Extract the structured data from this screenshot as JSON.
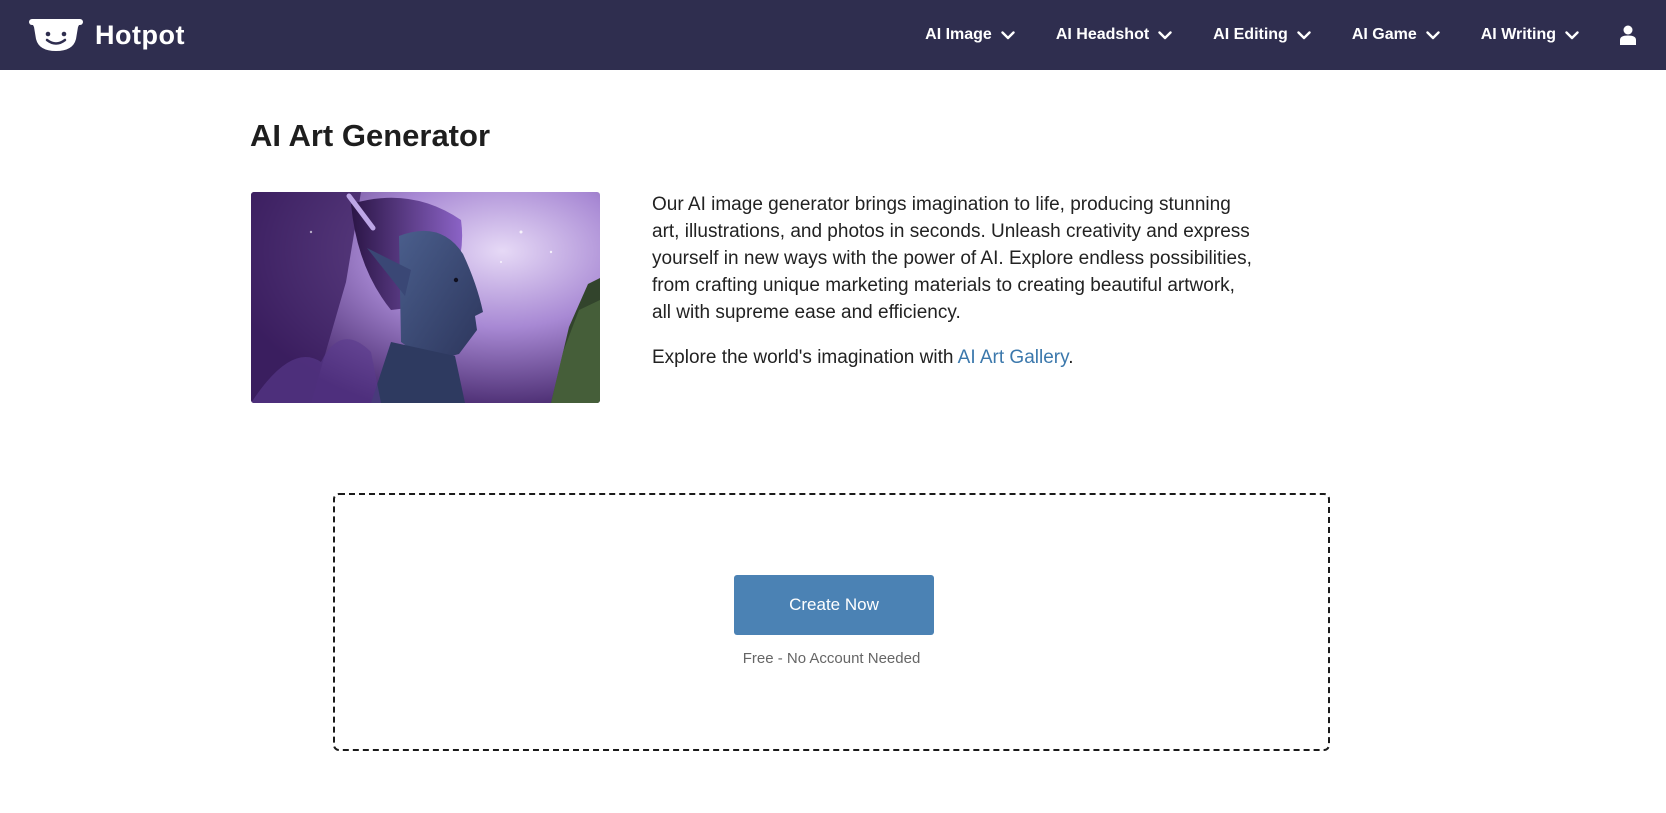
{
  "header": {
    "brand": "Hotpot",
    "nav": [
      {
        "label": "AI Image"
      },
      {
        "label": "AI Headshot"
      },
      {
        "label": "AI Editing"
      },
      {
        "label": "AI Game"
      },
      {
        "label": "AI Writing"
      }
    ],
    "icons": {
      "logo": "smiling-pot-logo",
      "chevron": "chevron-down-icon",
      "account": "user-icon"
    }
  },
  "main": {
    "title": "AI Art Generator",
    "description": "Our AI image generator brings imagination to life, producing stunning art, illustrations, and photos in seconds. Unleash creativity and express yourself in new ways with the power of AI. Explore endless possibilities, from crafting unique marketing materials to creating beautiful artwork, all with supreme ease and efficiency.",
    "explore_prefix": "Explore the world's imagination with ",
    "gallery_link": "AI Art Gallery",
    "explore_suffix": ".",
    "cta_label": "Create Now",
    "cta_note": "Free - No Account Needed"
  },
  "colors": {
    "header_bg": "#2f2e4f",
    "button_bg": "#4b82b4",
    "link": "#3b78ac"
  }
}
